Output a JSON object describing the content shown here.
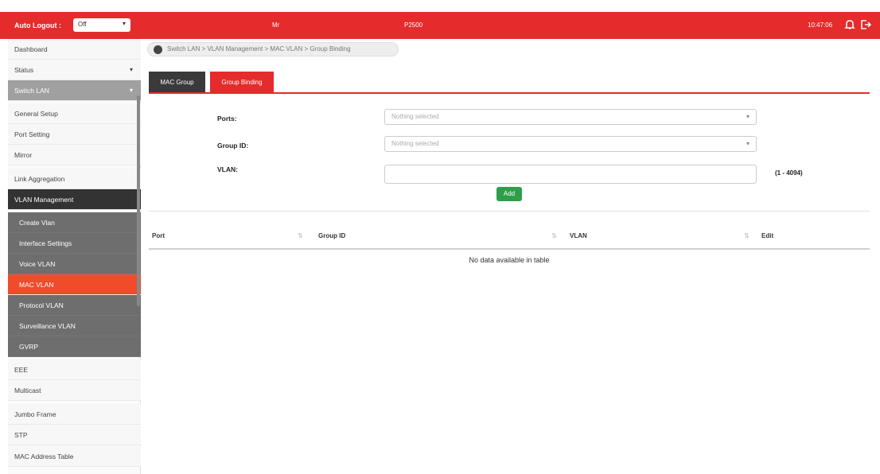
{
  "header": {
    "auto_logout_label": "Auto Logout :",
    "auto_logout_value": "Off",
    "model": "Mr",
    "device": "P2500",
    "time": "10:47:06",
    "accent": "#e52b2b"
  },
  "sidebar": {
    "items": [
      {
        "label": "Dashboard"
      },
      {
        "label": "Status",
        "caret": "▾"
      },
      {
        "label": "Switch LAN",
        "caret": "▾"
      },
      {
        "label": "General Setup"
      },
      {
        "label": "Port Setting"
      },
      {
        "label": "Mirror"
      },
      {
        "label": "Link Aggregation"
      },
      {
        "label": "VLAN Management"
      },
      {
        "label": "Create Vlan"
      },
      {
        "label": "Interface Settings"
      },
      {
        "label": "Voice VLAN"
      },
      {
        "label": "MAC VLAN"
      },
      {
        "label": "Protocol VLAN"
      },
      {
        "label": "Surveillance VLAN"
      },
      {
        "label": "GVRP"
      },
      {
        "label": "EEE"
      },
      {
        "label": "Multicast"
      },
      {
        "label": "Jumbo Frame"
      },
      {
        "label": "STP"
      },
      {
        "label": "MAC Address Table"
      }
    ]
  },
  "breadcrumb": "Switch LAN > VLAN Management > MAC VLAN > Group Binding",
  "tabs": [
    {
      "label": "MAC Group"
    },
    {
      "label": "Group Binding"
    }
  ],
  "form": {
    "ports_label": "Ports:",
    "ports_value": "Nothing selected",
    "group_label": "Group ID:",
    "group_value": "Nothing selected",
    "vlan_label": "VLAN:",
    "vlan_range": "(1 - 4094)",
    "add_label": "Add"
  },
  "table": {
    "columns": [
      "Port",
      "Group ID",
      "VLAN",
      "Edit"
    ],
    "empty_text": "No data available in table"
  }
}
